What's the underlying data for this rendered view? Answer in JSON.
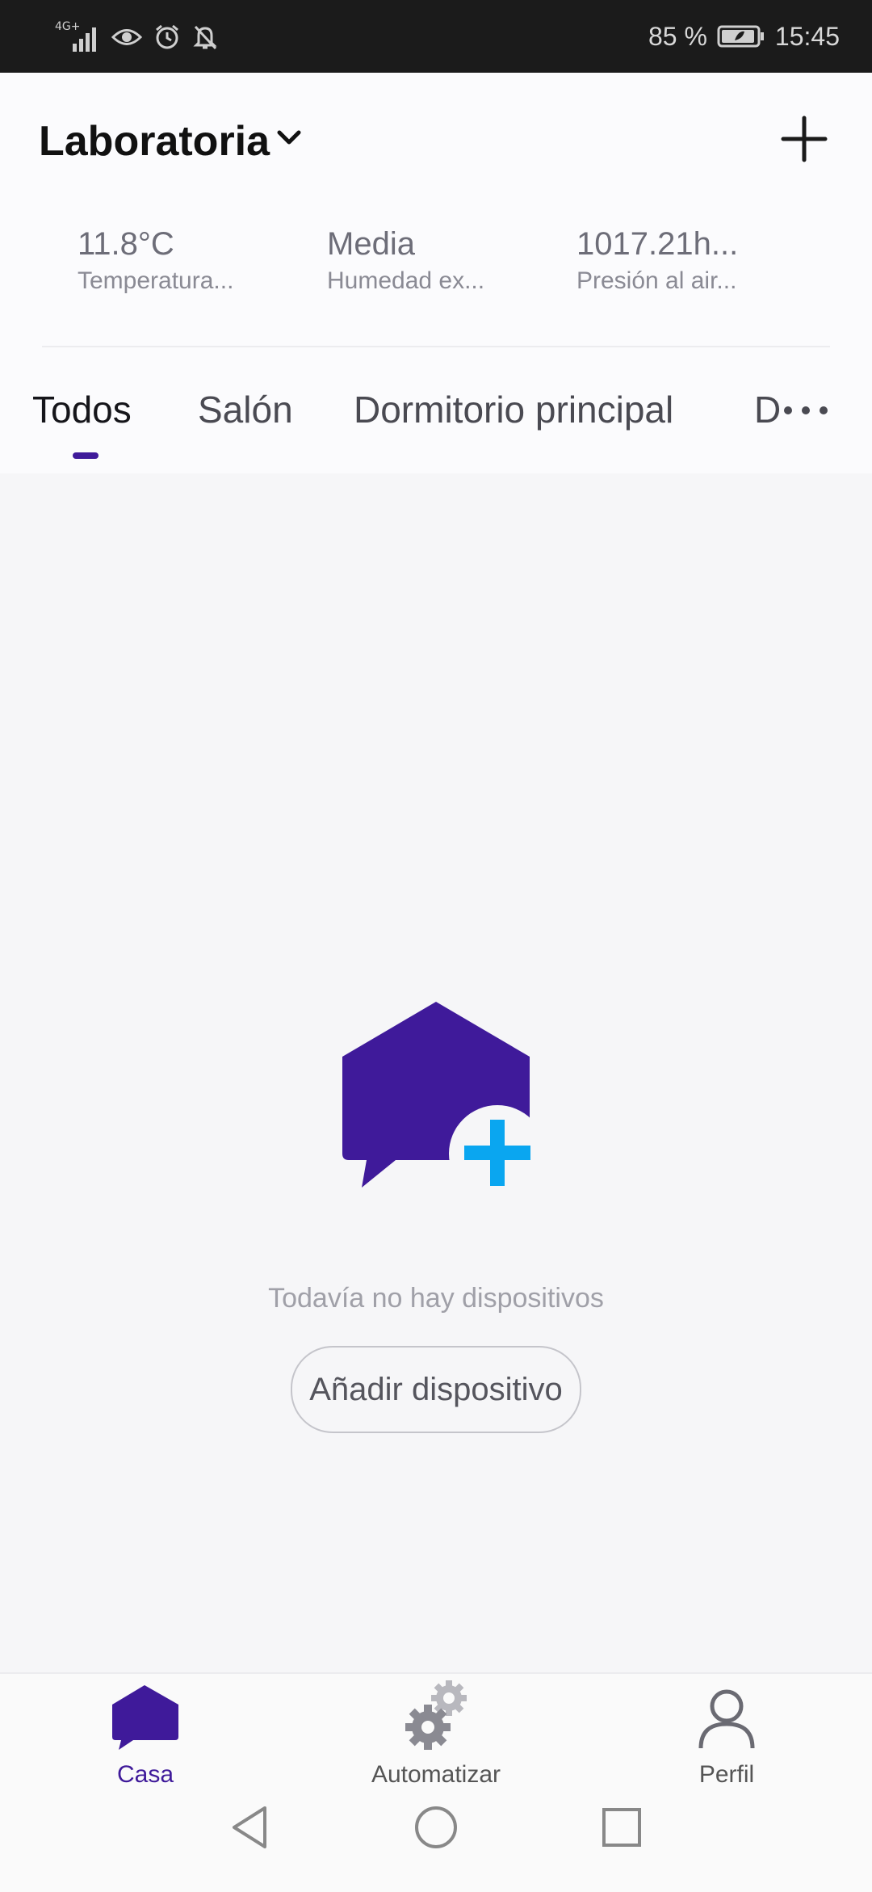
{
  "status_bar": {
    "network": "4G+",
    "battery": "85 %",
    "time": "15:45"
  },
  "header": {
    "home_name": "Laboratoria",
    "weather": [
      {
        "value": "11.8°C",
        "label": "Temperatura..."
      },
      {
        "value": "Media",
        "label": "Humedad ex..."
      },
      {
        "value": "1017.21h...",
        "label": "Presión al air..."
      }
    ]
  },
  "tabs": [
    {
      "label": "Todos",
      "active": true
    },
    {
      "label": "Salón",
      "active": false
    },
    {
      "label": "Dormitorio principal",
      "active": false
    },
    {
      "label": "D",
      "active": false
    }
  ],
  "empty_state": {
    "message": "Todavía no hay dispositivos",
    "button_label": "Añadir dispositivo"
  },
  "bottom_nav": [
    {
      "label": "Casa",
      "icon": "home-icon",
      "active": true
    },
    {
      "label": "Automatizar",
      "icon": "gears-icon",
      "active": false
    },
    {
      "label": "Perfil",
      "icon": "person-icon",
      "active": false
    }
  ],
  "colors": {
    "accent": "#3f1a9a",
    "plus_accent": "#0aa6f0"
  }
}
